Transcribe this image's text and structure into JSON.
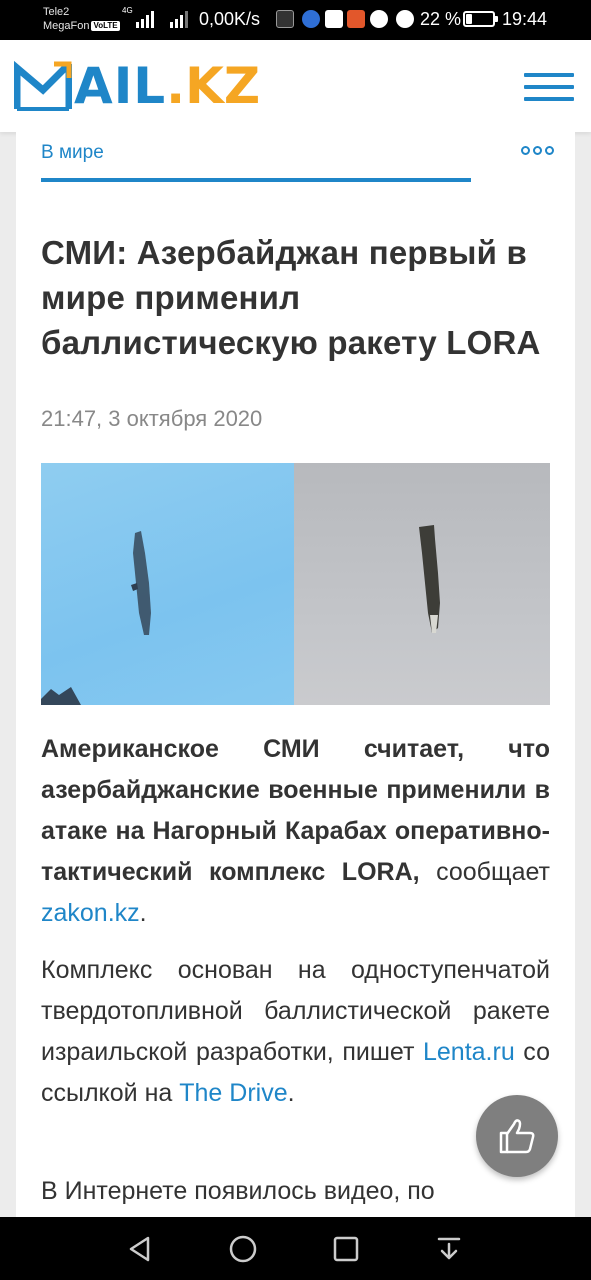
{
  "status_bar": {
    "carrier1": "Tele2",
    "carrier2": "MegaFon",
    "volte": "VoLTE",
    "network": "4G",
    "net_speed": "0,00K/s",
    "battery": "22 %",
    "battery_level": 0.22,
    "time": "19:44"
  },
  "header": {
    "logo_main": "AIL",
    "logo_dot": ".",
    "logo_kz": "KZ",
    "menu_icon": "hamburger-icon"
  },
  "article": {
    "rubric": "В мире",
    "title": "СМИ: Азербайджан первый в мире применил баллистическую ракету LORA",
    "date": "21:47, 3 октября 2020",
    "lead_bold": "Американское СМИ считает, что азербайджанские военные применили в атаке на Нагорный Карабах оперативно-тактический комплекс LORA,",
    "lead_normal": " сообщает ",
    "lead_link": "zakon.kz",
    "lead_end": ".",
    "p2_text1": "Комплекс основан на одноступенчатой твердотопливной баллистической ракете израильской разработки, пишет ",
    "p2_link1": "Lenta.ru",
    "p2_text2": " со ссылкой на ",
    "p2_link2": "The Drive",
    "p2_end": ".",
    "p3_text": "В Интернете появилось видео, по"
  },
  "colors": {
    "accent": "#1f86c8",
    "logo_orange": "#f5a623"
  }
}
